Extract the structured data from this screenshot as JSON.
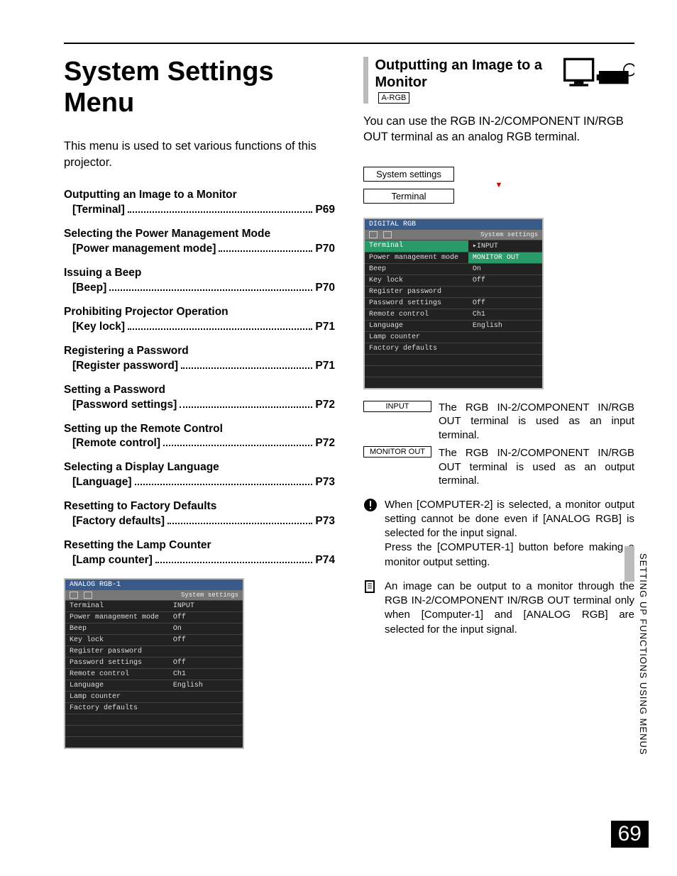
{
  "page_number": "69",
  "side_tab": "SETTING UP FUNCTIONS USING MENUS",
  "title": "System Settings Menu",
  "intro": "This menu is used to set various functions of this projector.",
  "toc": [
    {
      "title": "Outputting an Image to a Monitor",
      "sub": "[Terminal]",
      "page": "P69"
    },
    {
      "title": "Selecting the Power Management Mode",
      "sub": "[Power management mode]",
      "page": "P70"
    },
    {
      "title": "Issuing a Beep",
      "sub": "[Beep]",
      "page": "P70"
    },
    {
      "title": "Prohibiting Projector Operation",
      "sub": "[Key lock]",
      "page": "P71"
    },
    {
      "title": "Registering a Password",
      "sub": "[Register password]",
      "page": "P71"
    },
    {
      "title": "Setting a Password",
      "sub": "[Password settings]",
      "page": "P72"
    },
    {
      "title": "Setting up the Remote Control",
      "sub": "[Remote control]",
      "page": "P72"
    },
    {
      "title": "Selecting a Display Language",
      "sub": "[Language]",
      "page": "P73"
    },
    {
      "title": "Resetting to Factory Defaults",
      "sub": "[Factory defaults]",
      "page": "P73"
    },
    {
      "title": "Resetting the Lamp Counter",
      "sub": "[Lamp counter]",
      "page": "P74"
    }
  ],
  "left_menu": {
    "banner": "ANALOG RGB-1",
    "tab_label": "System settings",
    "rows": [
      {
        "label": "Terminal",
        "value": "INPUT"
      },
      {
        "label": "Power management mode",
        "value": "Off"
      },
      {
        "label": "Beep",
        "value": "On"
      },
      {
        "label": "Key lock",
        "value": "Off"
      },
      {
        "label": "Register password",
        "value": ""
      },
      {
        "label": "Password settings",
        "value": "Off"
      },
      {
        "label": "Remote control",
        "value": "Ch1"
      },
      {
        "label": "Language",
        "value": "English"
      },
      {
        "label": "Lamp counter",
        "value": ""
      },
      {
        "label": "Factory defaults",
        "value": ""
      }
    ]
  },
  "right": {
    "heading": "Outputting an Image to a Monitor",
    "badge": "A-RGB",
    "lead": "You can use the RGB IN-2/COMPONENT IN/RGB OUT terminal as an analog RGB terminal.",
    "nav": {
      "top": "System settings",
      "bottom": "Terminal"
    },
    "menu": {
      "banner": "DIGITAL RGB",
      "tab_label": "System settings",
      "rows": [
        {
          "label": "Terminal",
          "value": "▸INPUT",
          "hl_label": true
        },
        {
          "label": "Power management mode",
          "value": "MONITOR OUT",
          "hl_value": true
        },
        {
          "label": "Beep",
          "value": "On"
        },
        {
          "label": "Key lock",
          "value": "Off"
        },
        {
          "label": "Register password",
          "value": ""
        },
        {
          "label": "Password settings",
          "value": "Off"
        },
        {
          "label": "Remote control",
          "value": "Ch1"
        },
        {
          "label": "Language",
          "value": "English"
        },
        {
          "label": "Lamp counter",
          "value": ""
        },
        {
          "label": "Factory defaults",
          "value": ""
        }
      ]
    },
    "defs": [
      {
        "tag": "INPUT",
        "text": "The RGB IN-2/COMPONENT IN/RGB OUT terminal is used as an input terminal."
      },
      {
        "tag": "MONITOR OUT",
        "text": "The RGB IN-2/COMPONENT IN/RGB OUT terminal is used as an output terminal."
      }
    ],
    "note1": "When [COMPUTER-2] is selected, a monitor output setting cannot be done even if [ANALOG RGB] is selected for the input signal.\nPress the [COMPUTER-1] button before making a monitor output setting.",
    "note2": "An image can be output to a monitor through the RGB IN-2/COMPONENT IN/RGB OUT terminal only when [Computer-1] and [ANALOG RGB] are selected for the input signal."
  }
}
